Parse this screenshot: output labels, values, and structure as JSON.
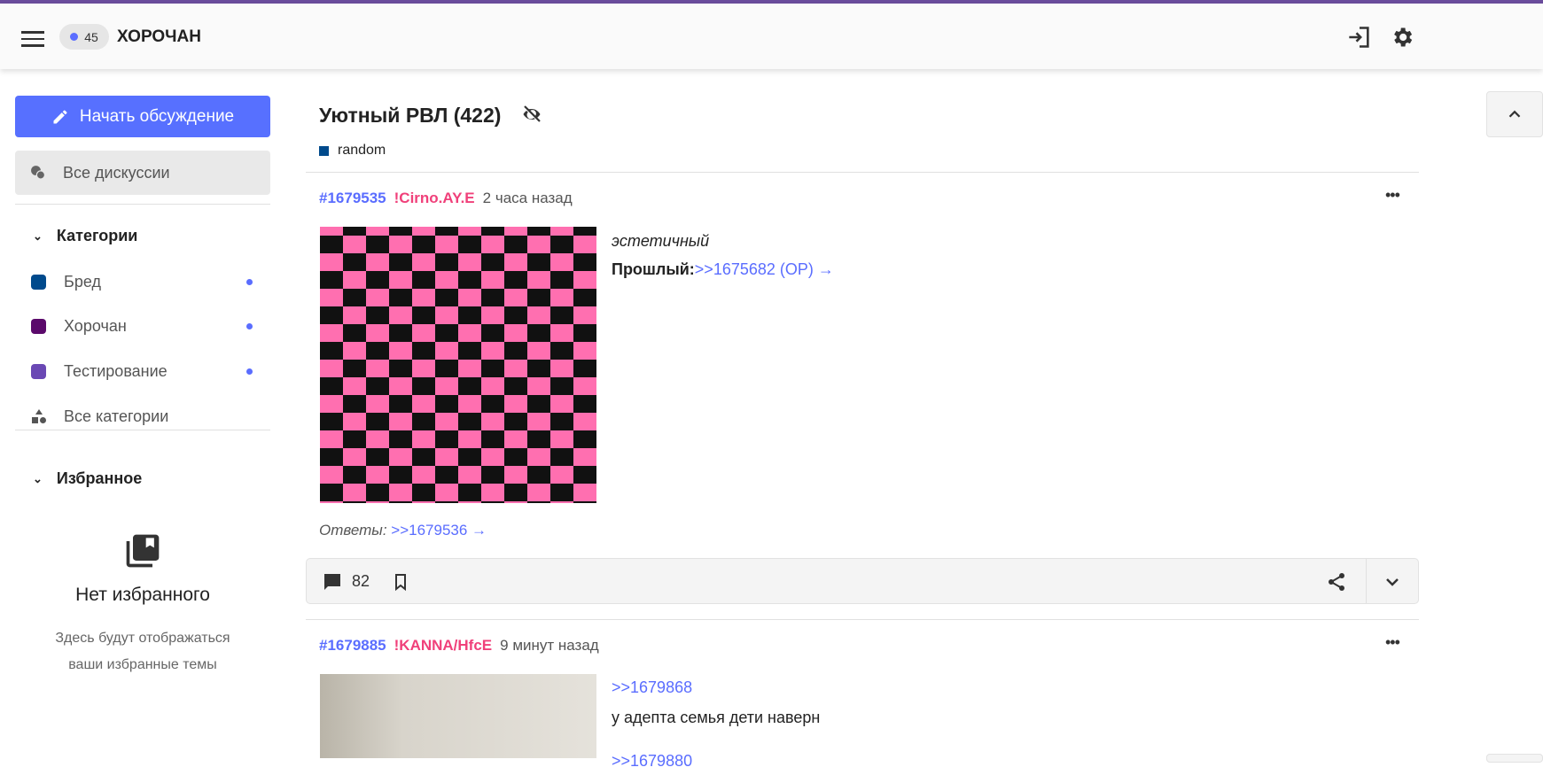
{
  "header": {
    "online_count": "45",
    "brand": "ХОРОЧАН"
  },
  "sidebar": {
    "start_discussion": "Начать обсуждение",
    "all_discussions": "Все дискуссии",
    "categories_heading": "Категории",
    "categories": [
      {
        "label": "Бред",
        "color": "#004a8c"
      },
      {
        "label": "Хорочан",
        "color": "#5b0a6b"
      },
      {
        "label": "Тестирование",
        "color": "#6a48b4"
      }
    ],
    "all_categories": "Все категории",
    "favorites_heading": "Избранное",
    "empty_title": "Нет избранного",
    "empty_desc_1": "Здесь будут отображаться",
    "empty_desc_2": "ваши избранные темы"
  },
  "thread": {
    "title": "Уютный РВЛ (422)",
    "tag": "random"
  },
  "posts": [
    {
      "id": "#1679535",
      "author": "!Cirno.AY.E",
      "time": "2 часа назад",
      "line1": "эстетичный",
      "prev_label": "Прошлый:",
      "prev_link": ">>1675682 (OP) →",
      "replies_label": "Ответы:",
      "replies_link": ">>1679536 →",
      "comments": "82"
    },
    {
      "id": "#1679885",
      "author": "!KANNA/HfcE",
      "time": "9 минут назад",
      "quote": ">>1679868",
      "line1": "у адепта семья дети наверн",
      "quote2": ">>1679880"
    }
  ]
}
